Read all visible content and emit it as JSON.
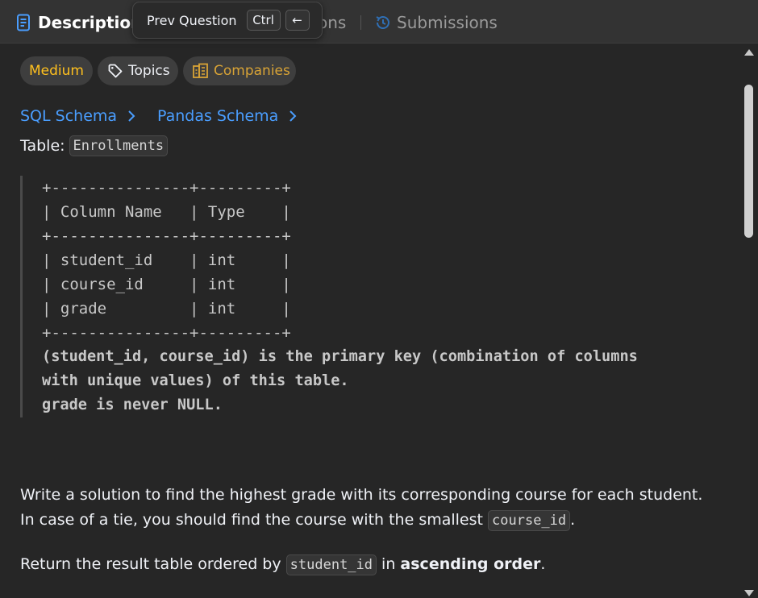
{
  "tabs": {
    "description": "Description",
    "solutions_partial": "ons",
    "submissions": "Submissions"
  },
  "tooltip": {
    "label": "Prev Question",
    "key1": "Ctrl",
    "key2": "←"
  },
  "tags": {
    "difficulty": "Medium",
    "topics": "Topics",
    "companies": "Companies"
  },
  "schema_links": {
    "sql": "SQL Schema",
    "pandas": "Pandas Schema"
  },
  "table_label": {
    "prefix": "Table:",
    "name": "Enrollments"
  },
  "schema_block": [
    "+---------------+---------+",
    "| Column Name   | Type    |",
    "+---------------+---------+",
    "| student_id    | int     |",
    "| course_id     | int     |",
    "| grade         | int     |",
    "+---------------+---------+"
  ],
  "schema_notes": [
    "(student_id, course_id) is the primary key (combination of columns",
    "with unique values) of this table.",
    "grade is never NULL."
  ],
  "problem": {
    "p1_a": "Write a solution to find the highest grade with its corresponding course for each student. In case of a tie, you should find the course with the smallest ",
    "p1_code": "course_id",
    "p1_b": ".",
    "p2_a": "Return the result table ordered by ",
    "p2_code": "student_id",
    "p2_b": " in ",
    "p2_bold": "ascending order",
    "p2_c": "."
  },
  "colors": {
    "accent_link": "#4a9eff",
    "medium": "#ffc01e",
    "companies": "#d8a336",
    "background": "#262626"
  },
  "icons": {
    "description": "document-icon",
    "submissions": "history-icon",
    "topics": "tag-icon",
    "companies": "building-icon",
    "chevron": "chevron-right-icon"
  }
}
